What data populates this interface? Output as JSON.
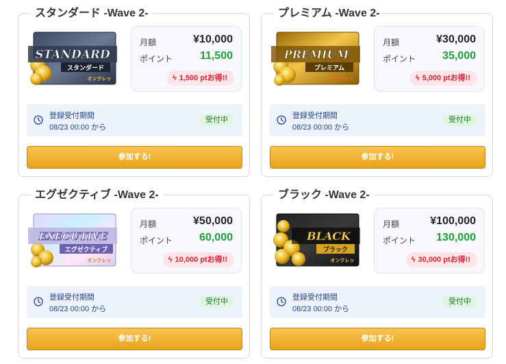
{
  "plans": [
    {
      "title": "スタンダード -Wave 2-",
      "banner": {
        "main": "STANDARD",
        "sub": "スタンダード",
        "brand": "オンクレッ",
        "style": "standard"
      },
      "monthly_label": "月額",
      "monthly_value": "¥10,000",
      "points_label": "ポイント",
      "points_value": "11,500",
      "bonus": "1,500 ptお得!!",
      "period_title": "登録受付期間",
      "period_date": "08/23 00:00 から",
      "status": "受付中",
      "button": "参加する!"
    },
    {
      "title": "プレミアム -Wave 2-",
      "banner": {
        "main": "PREMIUM",
        "sub": "プレミアム",
        "brand": "オンクレッ",
        "style": "premium"
      },
      "monthly_label": "月額",
      "monthly_value": "¥30,000",
      "points_label": "ポイント",
      "points_value": "35,000",
      "bonus": "5,000 ptお得!!",
      "period_title": "登録受付期間",
      "period_date": "08/23 00:00 から",
      "status": "受付中",
      "button": "参加する!"
    },
    {
      "title": "エグゼクティブ -Wave 2-",
      "banner": {
        "main": "EXECUTIVE",
        "sub": "エグゼクティブ",
        "brand": "オンクレッ",
        "style": "executive"
      },
      "monthly_label": "月額",
      "monthly_value": "¥50,000",
      "points_label": "ポイント",
      "points_value": "60,000",
      "bonus": "10,000 ptお得!!",
      "period_title": "登録受付期間",
      "period_date": "08/23 00:00 から",
      "status": "受付中",
      "button": "参加する!"
    },
    {
      "title": "ブラック -Wave 2-",
      "banner": {
        "main": "BLACK",
        "sub": "ブラック",
        "brand": "オンクレッ",
        "style": "black"
      },
      "monthly_label": "月額",
      "monthly_value": "¥100,000",
      "points_label": "ポイント",
      "points_value": "130,000",
      "bonus": "30,000 ptお得!!",
      "period_title": "登録受付期間",
      "period_date": "08/23 00:00 から",
      "status": "受付中",
      "button": "参加する!"
    }
  ],
  "colors": {
    "points_green": "#1f9d3a",
    "bonus_red": "#d6243a",
    "bonus_bg": "#fde4e6",
    "period_text": "#25418b",
    "period_bg": "#edf3fc",
    "status_bg": "#dff5e0",
    "button_gold": "#f2b534"
  },
  "icons": {
    "bonus": "bolt-icon",
    "period": "clock-icon"
  }
}
